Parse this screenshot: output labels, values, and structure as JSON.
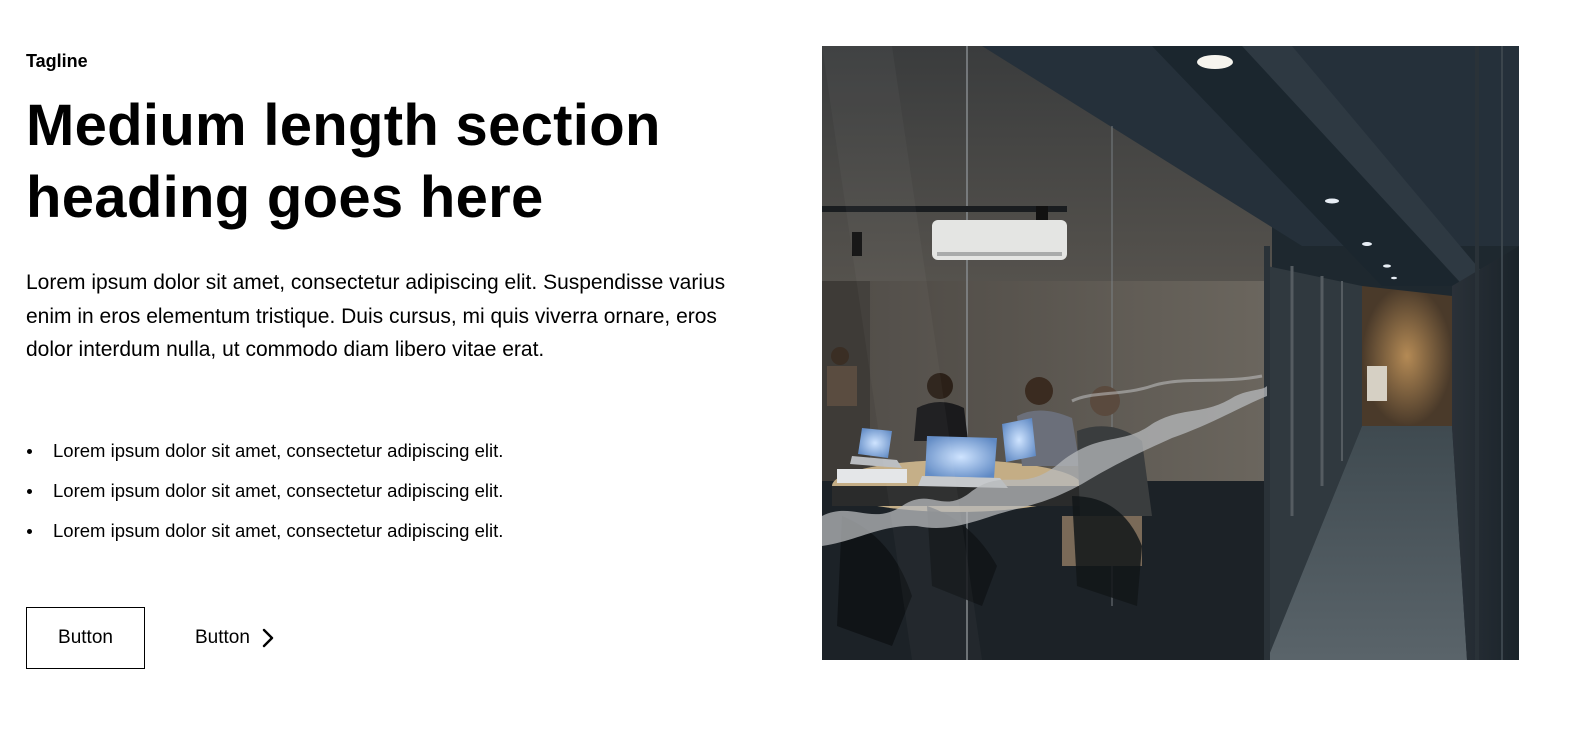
{
  "section": {
    "tagline": "Tagline",
    "heading": "Medium length section heading goes here",
    "lead": "Lorem ipsum dolor sit amet, consectetur adipiscing elit. Suspendisse varius enim in eros elementum tristique. Duis cursus, mi quis viverra ornare, eros dolor interdum nulla, ut commodo diam libero vitae erat.",
    "bullets": [
      "Lorem ipsum dolor sit amet, consectetur adipiscing elit.",
      "Lorem ipsum dolor sit amet, consectetur adipiscing elit.",
      "Lorem ipsum dolor sit amet, consectetur adipiscing elit."
    ],
    "primary_button_label": "Button",
    "secondary_button_label": "Button",
    "secondary_button_icon": "chevron-right-icon"
  },
  "image": {
    "icon": "office-meeting-room-photo"
  }
}
